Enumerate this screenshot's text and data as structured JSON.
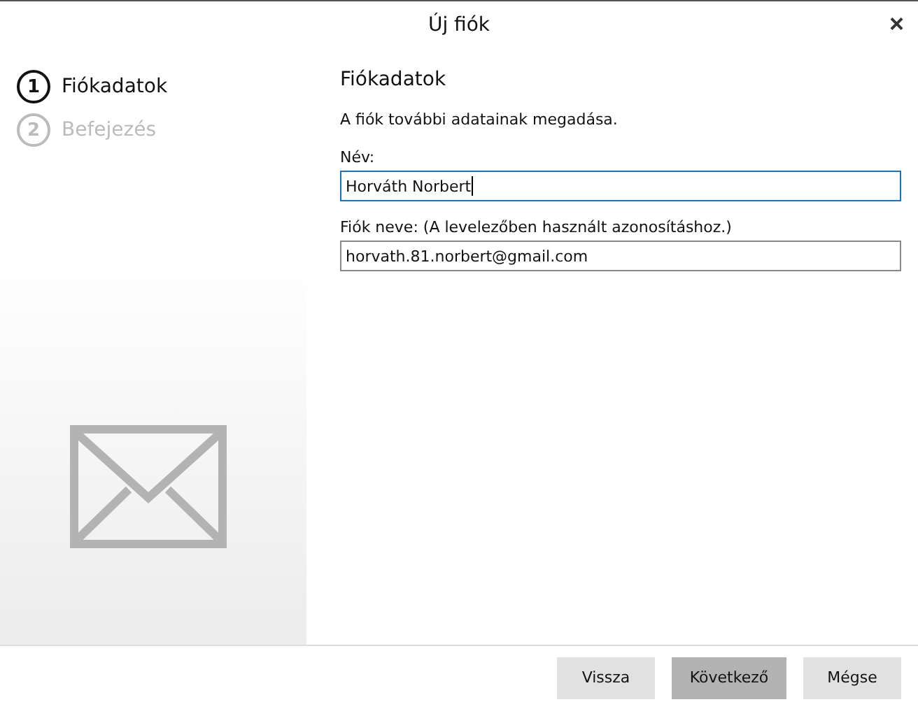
{
  "window": {
    "title": "Új fiók",
    "close": "×"
  },
  "steps": [
    {
      "number": "1",
      "label": "Fiókadatok",
      "selected": true
    },
    {
      "number": "2",
      "label": "Befejezés",
      "selected": false
    }
  ],
  "page": {
    "heading": "Fiókadatok",
    "description": "A fiók további adatainak megadása.",
    "fields": [
      {
        "label": "Név:",
        "value": "Horváth Norbert",
        "focused": true
      },
      {
        "label": "Fiók neve: (A levelezőben használt azonosításhoz.)",
        "value": "horvath.81.norbert@gmail.com",
        "focused": false
      }
    ]
  },
  "buttons": [
    {
      "label": "Vissza",
      "default": false
    },
    {
      "label": "Következő",
      "default": true
    },
    {
      "label": "Mégse",
      "default": false
    }
  ]
}
